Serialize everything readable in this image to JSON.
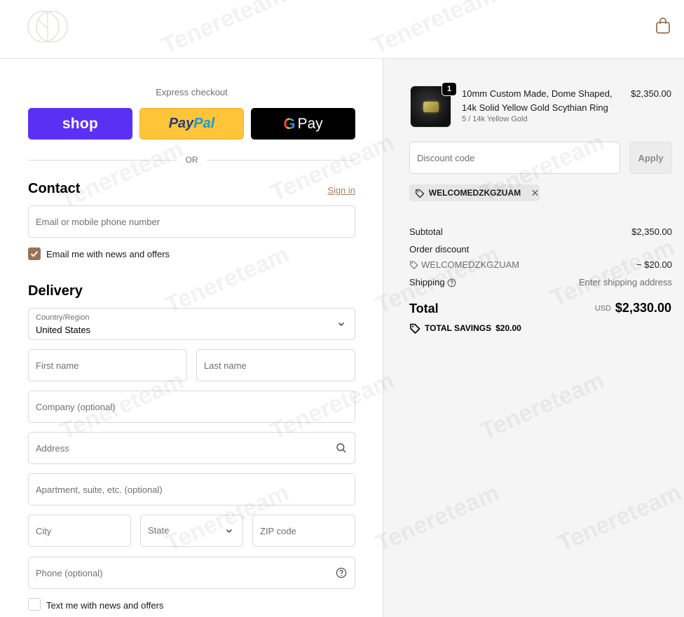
{
  "header": {
    "logo_name": "mh-monogram-logo",
    "cart_icon": "shopping-bag-icon"
  },
  "express": {
    "label": "Express checkout",
    "shop_label": "shop",
    "paypal_label_a": "Pay",
    "paypal_label_b": "Pal",
    "gpay_g": "G",
    "gpay_label": "Pay",
    "or_label": "OR"
  },
  "contact": {
    "title": "Contact",
    "signin_label": "Sign in",
    "email_placeholder": "Email or mobile phone number",
    "newsletter_label": "Email me with news and offers",
    "newsletter_checked": true
  },
  "delivery": {
    "title": "Delivery",
    "country_label": "Country/Region",
    "country_value": "United States",
    "first_name_placeholder": "First name",
    "last_name_placeholder": "Last name",
    "company_placeholder": "Company (optional)",
    "address_placeholder": "Address",
    "apartment_placeholder": "Apartment, suite, etc. (optional)",
    "city_placeholder": "City",
    "state_placeholder": "State",
    "zip_placeholder": "ZIP code",
    "phone_placeholder": "Phone (optional)",
    "sms_label": "Text me with news and offers",
    "sms_checked": false
  },
  "order": {
    "product_name": "10mm Custom Made, Dome Shaped, 14k Solid Yellow Gold Scythian Ring",
    "product_variant": "5 / 14k Yellow Gold",
    "product_price": "$2,350.00",
    "quantity": "1",
    "discount_placeholder": "Discount code",
    "apply_label": "Apply",
    "applied_code": "WELCOMEDZKGZUAM",
    "subtotal_label": "Subtotal",
    "subtotal_value": "$2,350.00",
    "order_discount_label": "Order discount",
    "discount_code_label": "WELCOMEDZKGZUAM",
    "discount_value": "− $20.00",
    "shipping_label": "Shipping",
    "shipping_value": "Enter shipping address",
    "total_label": "Total",
    "currency": "USD",
    "total_value": "$2,330.00",
    "savings_label": "TOTAL SAVINGS",
    "savings_value": "$20.00"
  },
  "watermark": {
    "text": "Tenereteam"
  },
  "colors": {
    "shop": "#5a31f4",
    "paypal": "#ffc439",
    "gpay": "#000000",
    "accent": "#9b7253"
  }
}
